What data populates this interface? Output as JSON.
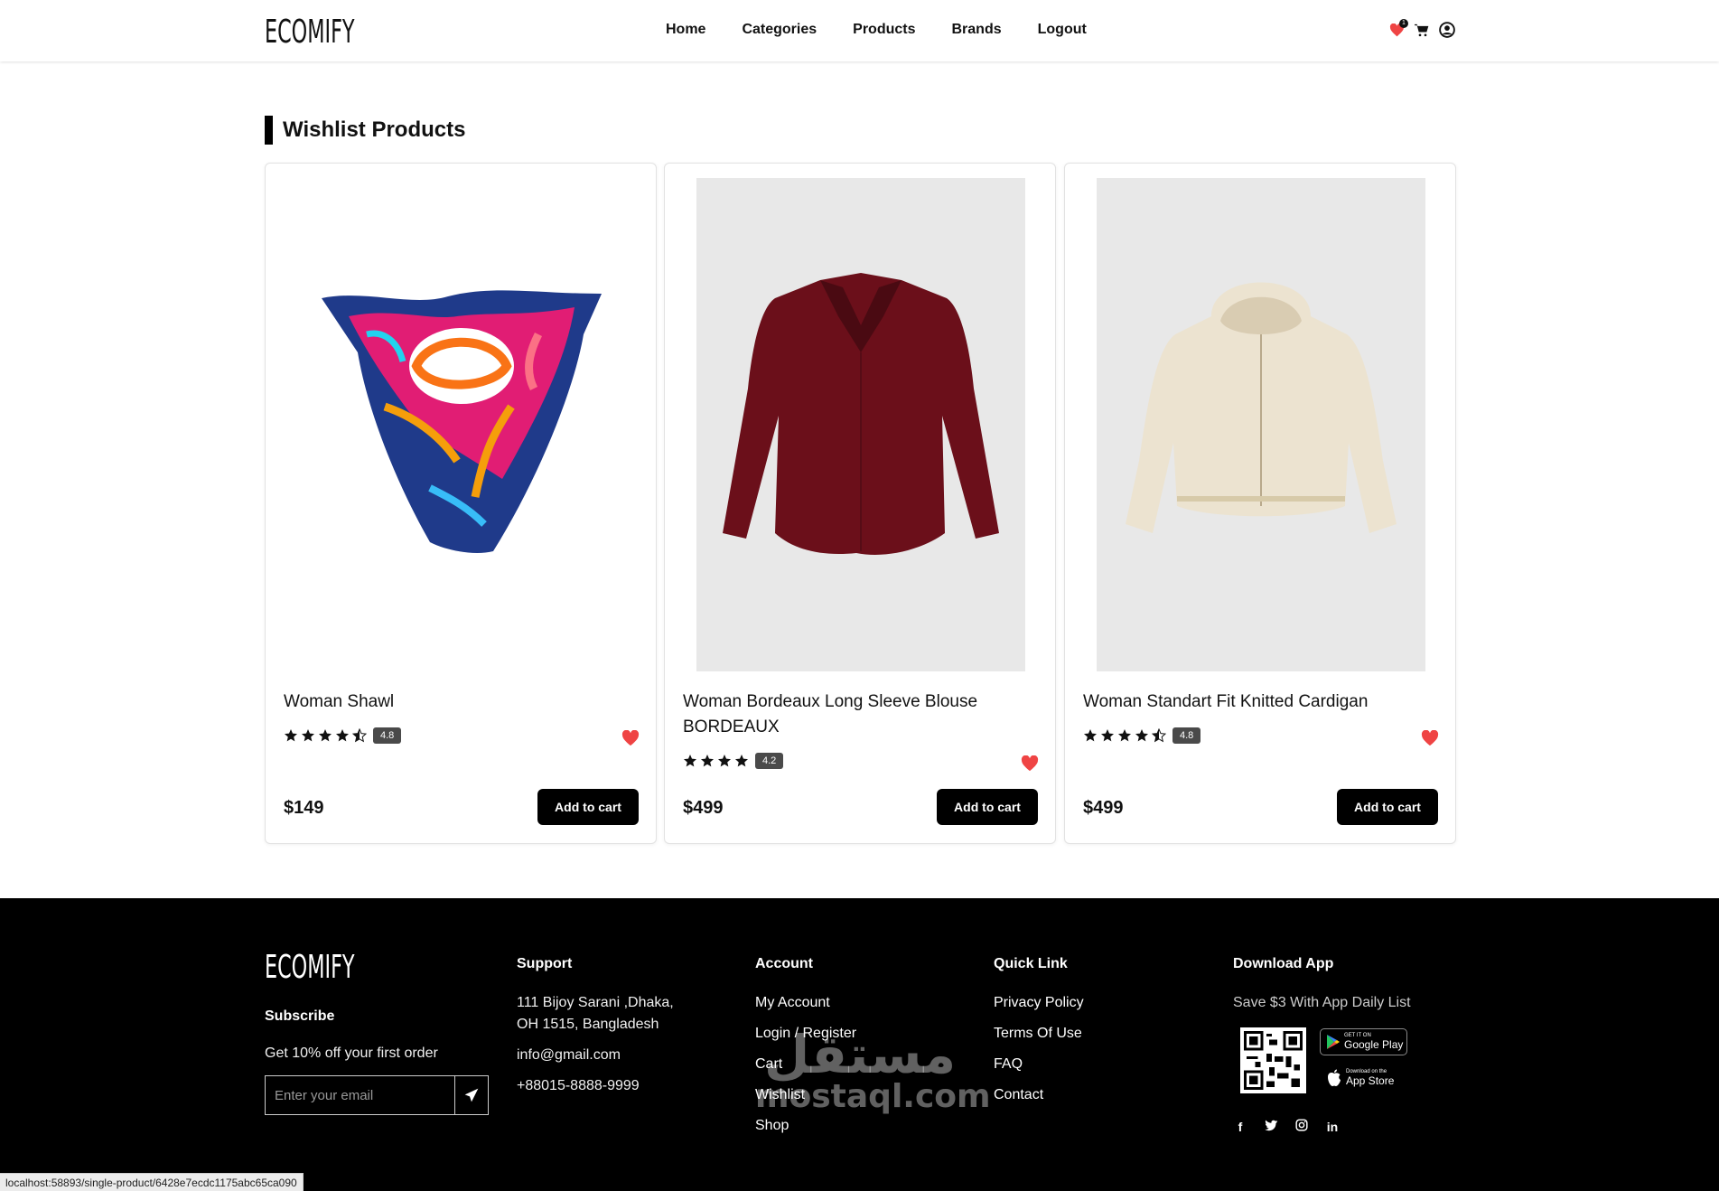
{
  "header": {
    "logo": "ECOMIFY",
    "nav": [
      "Home",
      "Categories",
      "Products",
      "Brands",
      "Logout"
    ],
    "wishlist_count": "1"
  },
  "section": {
    "title": "Wishlist Products"
  },
  "products": [
    {
      "name": "Woman Shawl",
      "rating": "4.8",
      "stars": 4.5,
      "price": "$149",
      "button": "Add to cart"
    },
    {
      "name": "Woman Bordeaux Long Sleeve Blouse BORDEAUX",
      "rating": "4.2",
      "stars": 4,
      "price": "$499",
      "button": "Add to cart"
    },
    {
      "name": "Woman Standart Fit Knitted Cardigan",
      "rating": "4.8",
      "stars": 4.5,
      "price": "$499",
      "button": "Add to cart"
    }
  ],
  "footer": {
    "logo": "ECOMIFY",
    "subscribe": {
      "title": "Subscribe",
      "text": "Get 10% off your first order",
      "placeholder": "Enter your email"
    },
    "support": {
      "title": "Support",
      "address_line1": "111 Bijoy Sarani ,Dhaka,",
      "address_line2": "OH 1515, Bangladesh",
      "email": "info@gmail.com",
      "phone": "+88015-8888-9999"
    },
    "account": {
      "title": "Account",
      "items": [
        "My Account",
        "Login / Register",
        "Cart",
        "Wishlist",
        "Shop"
      ]
    },
    "quick_link": {
      "title": "Quick Link",
      "items": [
        "Privacy Policy",
        "Terms Of Use",
        "FAQ",
        "Contact"
      ]
    },
    "download": {
      "title": "Download App",
      "text": "Save $3 With App Daily List",
      "google_small": "GET IT ON",
      "google_big": "Google Play",
      "apple_small": "Download on the",
      "apple_big": "App Store"
    },
    "socials": [
      "facebook-icon",
      "twitter-icon",
      "instagram-icon",
      "linkedin-icon"
    ]
  },
  "watermark": {
    "arabic": "مستقل",
    "latin": "mostaql.com"
  },
  "status_url": "localhost:58893/single-product/6428e7ecdc1175abc65ca090",
  "colors": {
    "accent": "#000000",
    "heart": "#ef4444",
    "badge": "#4a4a4a"
  }
}
